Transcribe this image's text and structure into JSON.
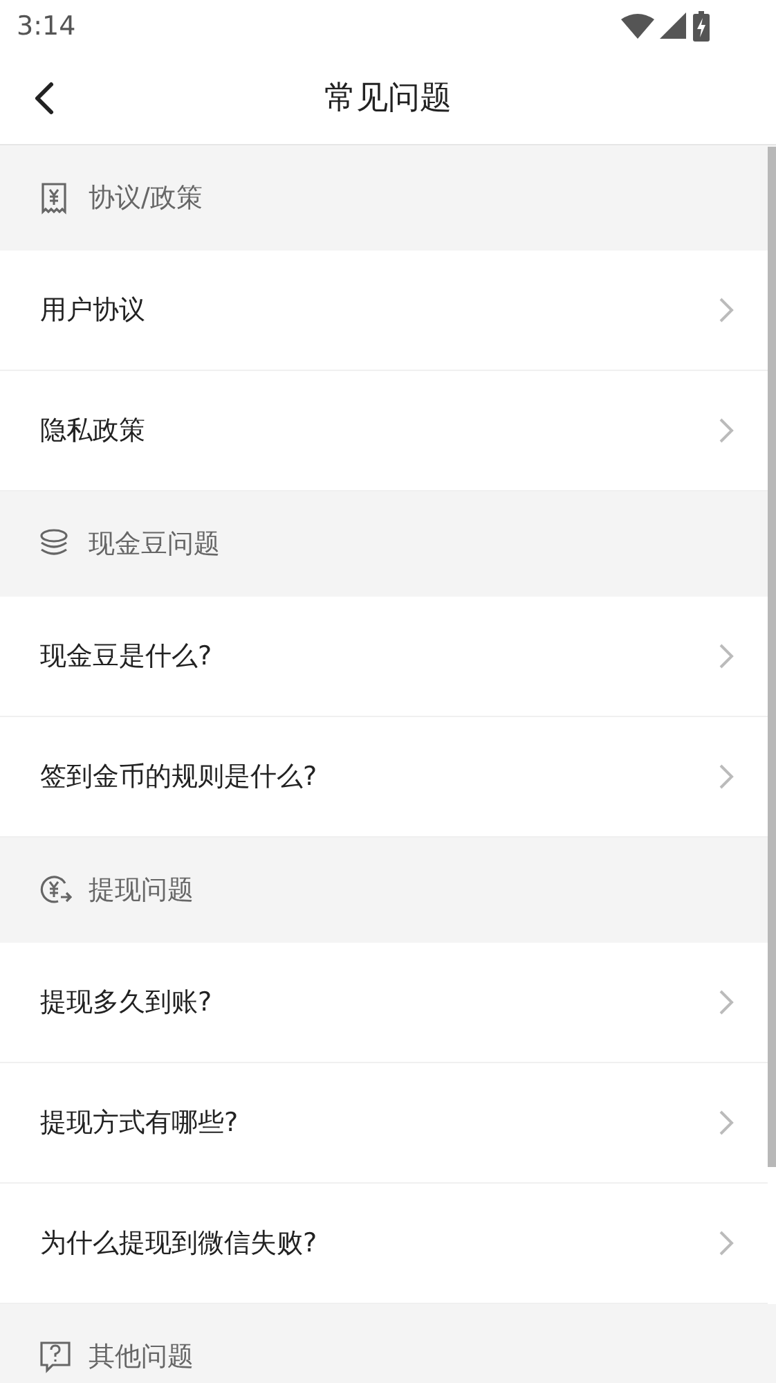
{
  "status_bar": {
    "time": "3:14"
  },
  "header": {
    "title": "常见问题"
  },
  "sections": [
    {
      "title": "协议/政策",
      "kind": "receipt",
      "items": [
        "用户协议",
        "隐私政策"
      ]
    },
    {
      "title": "现金豆问题",
      "kind": "coins",
      "items": [
        "现金豆是什么?",
        "签到金币的规则是什么?"
      ]
    },
    {
      "title": "提现问题",
      "kind": "withdraw",
      "items": [
        "提现多久到账?",
        "提现方式有哪些?",
        "为什么提现到微信失败?"
      ]
    },
    {
      "title": "其他问题",
      "kind": "question"
    }
  ]
}
